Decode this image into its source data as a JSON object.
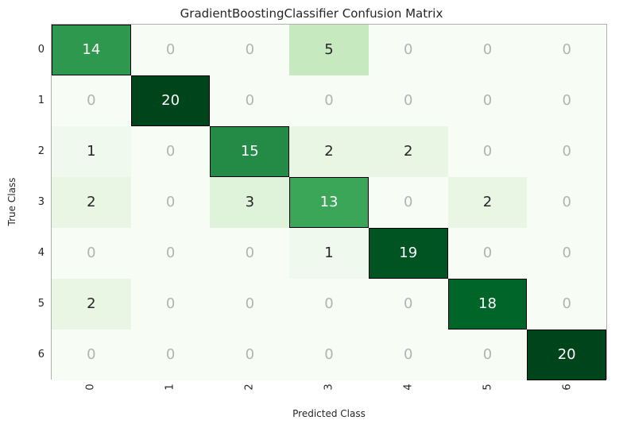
{
  "chart_data": {
    "type": "heatmap",
    "title": "GradientBoostingClassifier Confusion Matrix",
    "xlabel": "Predicted Class",
    "ylabel": "True Class",
    "x_categories": [
      "0",
      "1",
      "2",
      "3",
      "4",
      "5",
      "6"
    ],
    "y_categories": [
      "0",
      "1",
      "2",
      "3",
      "4",
      "5",
      "6"
    ],
    "matrix": [
      [
        14,
        0,
        0,
        5,
        0,
        0,
        0
      ],
      [
        0,
        20,
        0,
        0,
        0,
        0,
        0
      ],
      [
        1,
        0,
        15,
        2,
        2,
        0,
        0
      ],
      [
        2,
        0,
        3,
        13,
        0,
        2,
        0
      ],
      [
        0,
        0,
        0,
        1,
        19,
        0,
        0
      ],
      [
        2,
        0,
        0,
        0,
        0,
        18,
        0
      ],
      [
        0,
        0,
        0,
        0,
        0,
        0,
        20
      ]
    ],
    "value_range": [
      0,
      20
    ]
  },
  "palette": {
    "min": "#ffffff",
    "max": "#00441b",
    "cmap": "Greens"
  }
}
